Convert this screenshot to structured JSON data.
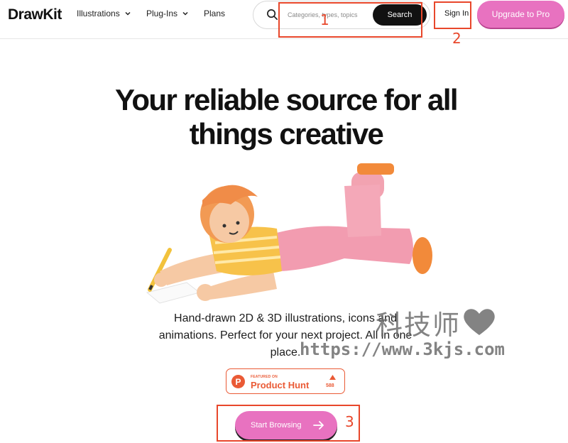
{
  "nav": {
    "logo": "DrawKit",
    "menu": [
      {
        "label": "Illustrations",
        "icon": "chevron-down-icon"
      },
      {
        "label": "Plug-Ins",
        "icon": "chevron-down-icon"
      },
      {
        "label": "Plans"
      }
    ],
    "search": {
      "placeholder": "Categories, types, topics",
      "value": "",
      "button_label": "Search",
      "icon": "search-icon"
    },
    "sign_in_label": "Sign In",
    "upgrade_label": "Upgrade to Pro"
  },
  "annotations": [
    "1",
    "2",
    "3"
  ],
  "hero": {
    "title_line1": "Your reliable source for all",
    "title_line2": "things creative",
    "description": "Hand-drawn 2D & 3D illustrations, icons and animations. Perfect for your next project. All in one place.",
    "product_hunt": {
      "featured_label": "FEATURED ON",
      "name": "Product Hunt",
      "count": "588",
      "logo_letter": "P"
    },
    "cta_label": "Start Browsing",
    "cta_icon": "arrow-right-icon"
  },
  "watermark": {
    "chinese": "科技师",
    "url": "https://www.3kjs.com"
  },
  "colors": {
    "accent_pink": "#e872c0",
    "annotation_red": "#e8472b",
    "product_hunt": "#ea5a35"
  }
}
